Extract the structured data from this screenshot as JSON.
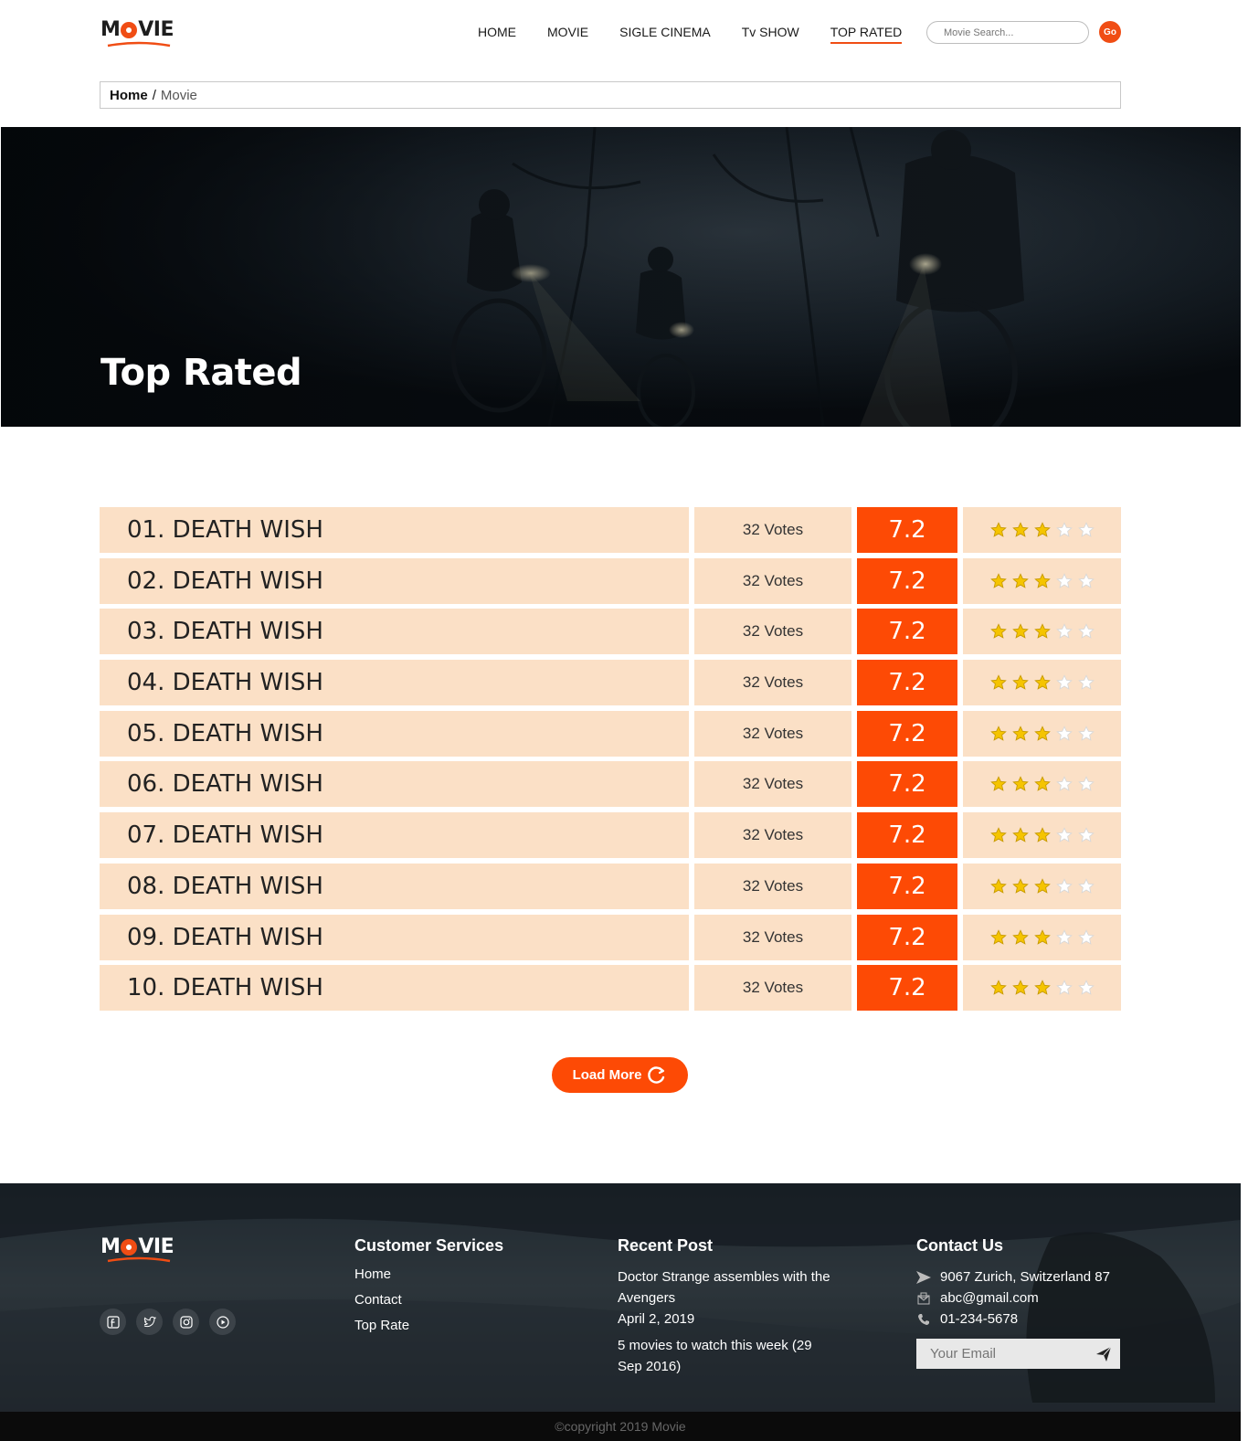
{
  "brand": {
    "logo_text": "MOVIE",
    "accent_color": "#fd4a05",
    "row_bg": "#fbe0c6"
  },
  "nav": {
    "items": [
      {
        "label": "HOME"
      },
      {
        "label": "MOVIE"
      },
      {
        "label": "SIGLE CINEMA"
      },
      {
        "label": "Tv SHOW"
      },
      {
        "label": "TOP RATED"
      }
    ],
    "active_index": 4,
    "search_placeholder": "Movie Search...",
    "go_label": "Go"
  },
  "breadcrumb": {
    "home": "Home",
    "separator": "/",
    "current": "Movie"
  },
  "hero": {
    "title": "Top Rated"
  },
  "ranking": {
    "rows": [
      {
        "title": "01. DEATH WISH",
        "votes": "32 Votes",
        "score": "7.2",
        "stars": 3,
        "max_stars": 5
      },
      {
        "title": "02. DEATH WISH",
        "votes": "32 Votes",
        "score": "7.2",
        "stars": 3,
        "max_stars": 5
      },
      {
        "title": "03. DEATH WISH",
        "votes": "32 Votes",
        "score": "7.2",
        "stars": 3,
        "max_stars": 5
      },
      {
        "title": "04. DEATH WISH",
        "votes": "32 Votes",
        "score": "7.2",
        "stars": 3,
        "max_stars": 5
      },
      {
        "title": "05. DEATH WISH",
        "votes": "32 Votes",
        "score": "7.2",
        "stars": 3,
        "max_stars": 5
      },
      {
        "title": "06. DEATH WISH",
        "votes": "32 Votes",
        "score": "7.2",
        "stars": 3,
        "max_stars": 5
      },
      {
        "title": "07. DEATH WISH",
        "votes": "32 Votes",
        "score": "7.2",
        "stars": 3,
        "max_stars": 5
      },
      {
        "title": "08. DEATH WISH",
        "votes": "32 Votes",
        "score": "7.2",
        "stars": 3,
        "max_stars": 5
      },
      {
        "title": "09. DEATH WISH",
        "votes": "32 Votes",
        "score": "7.2",
        "stars": 3,
        "max_stars": 5
      },
      {
        "title": "10. DEATH WISH",
        "votes": "32 Votes",
        "score": "7.2",
        "stars": 3,
        "max_stars": 5
      }
    ],
    "load_more_label": "Load More"
  },
  "footer": {
    "logo_text": "MOVIE",
    "social_icons": [
      "facebook-icon",
      "twitter-icon",
      "instagram-icon",
      "play-icon"
    ],
    "customer_services": {
      "heading": "Customer Services",
      "links": [
        "Home",
        "Contact",
        "Top Rate"
      ]
    },
    "recent_post": {
      "heading": "Recent Post",
      "posts": [
        {
          "title": "Doctor Strange assembles with the Avengers",
          "date": "April 2, 2019"
        },
        {
          "title": "5 movies to watch this week (29 Sep 2016)",
          "date": ""
        }
      ]
    },
    "contact": {
      "heading": "Contact Us",
      "address": "9067 Zurich, Switzerland 87",
      "email": "abc@gmail.com",
      "phone": "01-234-5678",
      "newsletter_placeholder": "Your Email"
    },
    "copyright": "©copyright 2019 Movie"
  }
}
